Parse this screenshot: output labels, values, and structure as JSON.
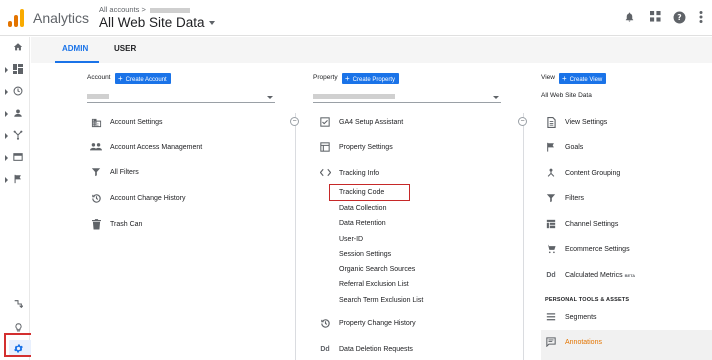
{
  "header": {
    "app_name": "Analytics",
    "account_path": "All accounts >",
    "account_path_blurred": "",
    "property_view": "All Web Site Data",
    "icons": [
      "bell-icon",
      "apps-icon",
      "help-icon",
      "more-vert-icon"
    ],
    "logo_colors": [
      "#f9ab00",
      "#e37400",
      "#e37400"
    ]
  },
  "sidebar": {
    "items": [
      {
        "icon": "home-icon",
        "has_arrow": false
      },
      {
        "icon": "customization-icon",
        "has_arrow": true
      },
      {
        "icon": "realtime-icon",
        "has_arrow": true
      },
      {
        "icon": "audience-icon",
        "has_arrow": true
      },
      {
        "icon": "acquisition-icon",
        "has_arrow": true
      },
      {
        "icon": "behavior-icon",
        "has_arrow": true
      },
      {
        "icon": "conversions-icon",
        "has_arrow": true
      }
    ],
    "bottom": [
      "attribution-icon",
      "discover-icon",
      "admin-gear-icon"
    ]
  },
  "tabs": {
    "admin": "ADMIN",
    "user": "USER"
  },
  "account": {
    "heading": "Account",
    "create_label": "Create Account",
    "items": [
      {
        "label": "Account Settings",
        "icon": "building-icon"
      },
      {
        "label": "Account Access Management",
        "icon": "people-icon"
      },
      {
        "label": "All Filters",
        "icon": "filter-icon"
      },
      {
        "label": "Account Change History",
        "icon": "history-icon"
      },
      {
        "label": "Trash Can",
        "icon": "trash-icon"
      }
    ]
  },
  "property": {
    "heading": "Property",
    "create_label": "Create Property",
    "items_top": [
      {
        "label": "GA4 Setup Assistant",
        "icon": "checkbox-icon"
      },
      {
        "label": "Property Settings",
        "icon": "window-icon"
      },
      {
        "label": "Tracking Info",
        "icon": "code-icon"
      }
    ],
    "tracking_sub": [
      "Tracking Code",
      "Data Collection",
      "Data Retention",
      "User-ID",
      "Session Settings",
      "Organic Search Sources",
      "Referral Exclusion List",
      "Search Term Exclusion List"
    ],
    "items_bottom": [
      {
        "label": "Property Change History",
        "icon": "history-icon"
      },
      {
        "label": "Data Deletion Requests",
        "icon": "dd-icon"
      }
    ]
  },
  "view": {
    "heading": "View",
    "create_label": "Create View",
    "selected": "All Web Site Data",
    "items": [
      {
        "label": "View Settings",
        "icon": "doc-icon"
      },
      {
        "label": "Goals",
        "icon": "flag-icon"
      },
      {
        "label": "Content Grouping",
        "icon": "grouping-icon"
      },
      {
        "label": "Filters",
        "icon": "filter-icon"
      },
      {
        "label": "Channel Settings",
        "icon": "channel-icon"
      },
      {
        "label": "Ecommerce Settings",
        "icon": "cart-icon"
      },
      {
        "label": "Calculated Metrics",
        "icon": "dd-icon",
        "badge": "BETA"
      }
    ],
    "section_title": "PERSONAL TOOLS & ASSETS",
    "personal": [
      {
        "label": "Segments",
        "icon": "segments-icon"
      },
      {
        "label": "Annotations",
        "icon": "annotation-icon"
      }
    ]
  },
  "colors": {
    "accent": "#1a73e8",
    "highlight": "#c62828",
    "annotation_text": "#e37400"
  }
}
